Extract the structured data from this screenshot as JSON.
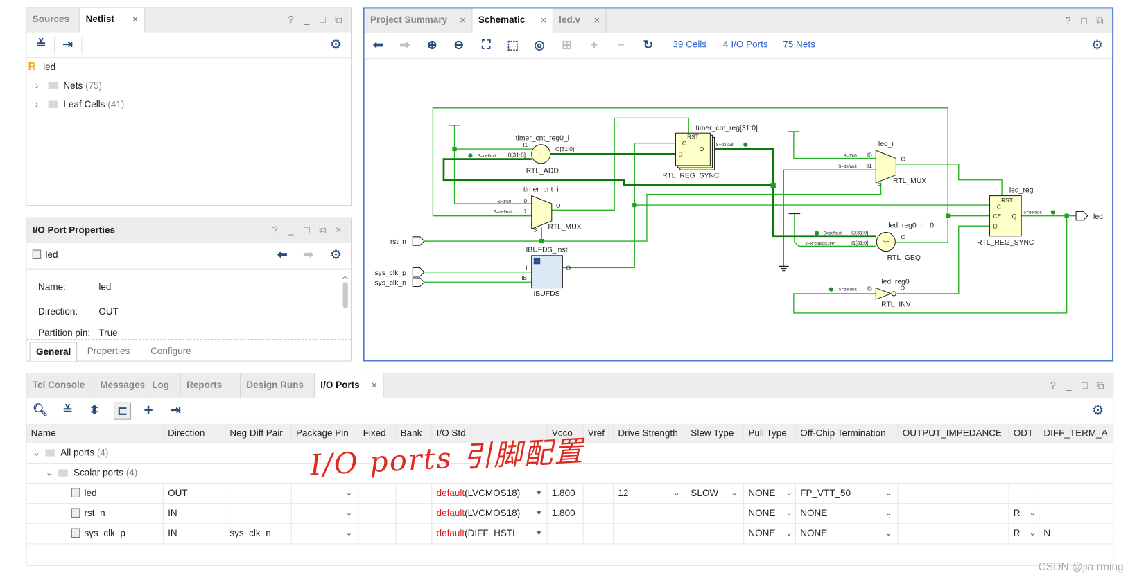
{
  "netlist_panel": {
    "tabs": [
      {
        "label": "Sources"
      },
      {
        "label": "Netlist",
        "active": true
      }
    ],
    "window_buttons": [
      "?",
      "_",
      "□",
      "⧉"
    ],
    "toolbar": [
      "collapse-all-icon",
      "expand-icon",
      "gear-icon"
    ],
    "root": {
      "badge": "R",
      "label": "led"
    },
    "items": [
      {
        "label": "Nets",
        "count": "(75)"
      },
      {
        "label": "Leaf Cells",
        "count": "(41)"
      }
    ]
  },
  "port_props": {
    "title": "I/O Port Properties",
    "object": "led",
    "fields": [
      {
        "label": "Name:",
        "value": "led"
      },
      {
        "label": "Direction:",
        "value": "OUT"
      },
      {
        "label": "Partition pin:",
        "value": "True"
      }
    ],
    "tabs": [
      {
        "label": "General",
        "active": true
      },
      {
        "label": "Properties"
      },
      {
        "label": "Configure"
      }
    ]
  },
  "schematic": {
    "tabs": [
      {
        "label": "Project Summary"
      },
      {
        "label": "Schematic",
        "active": true
      },
      {
        "label": "led.v"
      }
    ],
    "stats": {
      "cells": "39 Cells",
      "ports": "4 I/O Ports",
      "nets": "75 Nets"
    },
    "wire_color": "#22b222",
    "bus_color": "#0a7a0a",
    "cell_fill": "#ffffc8",
    "ports": {
      "rst_n": "rst_n",
      "sys_clk_p": "sys_clk_p",
      "sys_clk_n": "sys_clk_n",
      "led": "led"
    },
    "cells": {
      "add": {
        "inst": "timer_cnt_reg0_i",
        "type": "RTL_ADD",
        "sym": "+",
        "pin_i1": "I1",
        "pin_i0": "I0[31:0]",
        "pin_o": "O[31:0]",
        "attr": "S=default"
      },
      "mux1": {
        "inst": "timer_cnt_i",
        "type": "RTL_MUX",
        "pin_i0": "I0",
        "pin_i1": "I1",
        "pin_o": "O",
        "pin_s": "S",
        "attr0": "S=1'b0",
        "attr1": "S=default"
      },
      "reg1": {
        "inst": "timer_cnt_reg[31:0]",
        "type": "RTL_REG_SYNC",
        "rst": "RST",
        "c": "C",
        "d": "D",
        "q": "Q",
        "attr": "S=default"
      },
      "ibuf": {
        "inst": "IBUFDS_inst",
        "type": "IBUFDS",
        "pin_i": "I",
        "pin_ib": "IB",
        "pin_o": "O"
      },
      "mux2": {
        "inst": "led_i",
        "type": "RTL_MUX",
        "pin_i0": "I0",
        "pin_i1": "I1",
        "pin_o": "O",
        "pin_s": "S",
        "attr0": "S=1'b0",
        "attr1": "S=default"
      },
      "geq": {
        "inst": "led_reg0_i__0",
        "type": "RTL_GEQ",
        "sym": ">=",
        "pin_i0": "I0[31:0]",
        "pin_i1": "I1[31:0]",
        "pin_o": "O",
        "attr0": "S=default",
        "attr1": "V=X\"0BEBC1FF\""
      },
      "reg2": {
        "inst": "led_reg",
        "type": "RTL_REG_SYNC",
        "rst": "RST",
        "c": "C",
        "ce": "CE",
        "d": "D",
        "q": "Q",
        "attr": "S=default"
      },
      "inv": {
        "inst": "led_reg0_i",
        "type": "RTL_INV",
        "pin_i0": "I0",
        "pin_o": "O",
        "attr": "S=default"
      }
    }
  },
  "io_ports": {
    "tabs": [
      {
        "label": "Tcl Console"
      },
      {
        "label": "Messages"
      },
      {
        "label": "Log"
      },
      {
        "label": "Reports"
      },
      {
        "label": "Design Runs"
      },
      {
        "label": "I/O Ports",
        "active": true
      }
    ],
    "columns": [
      "Name",
      "Direction",
      "Neg Diff Pair",
      "Package Pin",
      "Fixed",
      "Bank",
      "I/O Std",
      "Vcco",
      "Vref",
      "Drive Strength",
      "Slew Type",
      "Pull Type",
      "Off-Chip Termination",
      "OUTPUT_IMPEDANCE",
      "ODT",
      "DIFF_TERM_A"
    ],
    "groups": [
      {
        "label": "All ports",
        "count": "(4)"
      },
      {
        "label": "Scalar ports",
        "count": "(4)"
      }
    ],
    "rows": [
      {
        "name": "led",
        "dir": "OUT",
        "neg": "",
        "pin": "",
        "fixed": "",
        "bank": "",
        "std_default": "default",
        "std": "(LVCMOS18)",
        "vcco": "1.800",
        "vref": "",
        "drive": "12",
        "slew": "SLOW",
        "pull": "NONE",
        "term": "FP_VTT_50",
        "imp": "",
        "odt": "",
        "diff": ""
      },
      {
        "name": "rst_n",
        "dir": "IN",
        "neg": "",
        "pin": "",
        "fixed": "",
        "bank": "",
        "std_default": "default",
        "std": "(LVCMOS18)",
        "vcco": "1.800",
        "vref": "",
        "drive": "",
        "slew": "",
        "pull": "NONE",
        "term": "NONE",
        "imp": "",
        "odt": "R",
        "diff": ""
      },
      {
        "name": "sys_clk_p",
        "dir": "IN",
        "neg": "sys_clk_n",
        "pin": "",
        "fixed": "",
        "bank": "",
        "std_default": "default",
        "std": "(DIFF_HSTL_",
        "vcco": "",
        "vref": "",
        "drive": "",
        "slew": "",
        "pull": "NONE",
        "term": "NONE",
        "imp": "",
        "odt": "R",
        "diff": "N"
      }
    ]
  },
  "annotation": {
    "handwritten": "I/O ports 引脚配置",
    "color": "#e0291f"
  },
  "watermark": "CSDN @jia rming"
}
